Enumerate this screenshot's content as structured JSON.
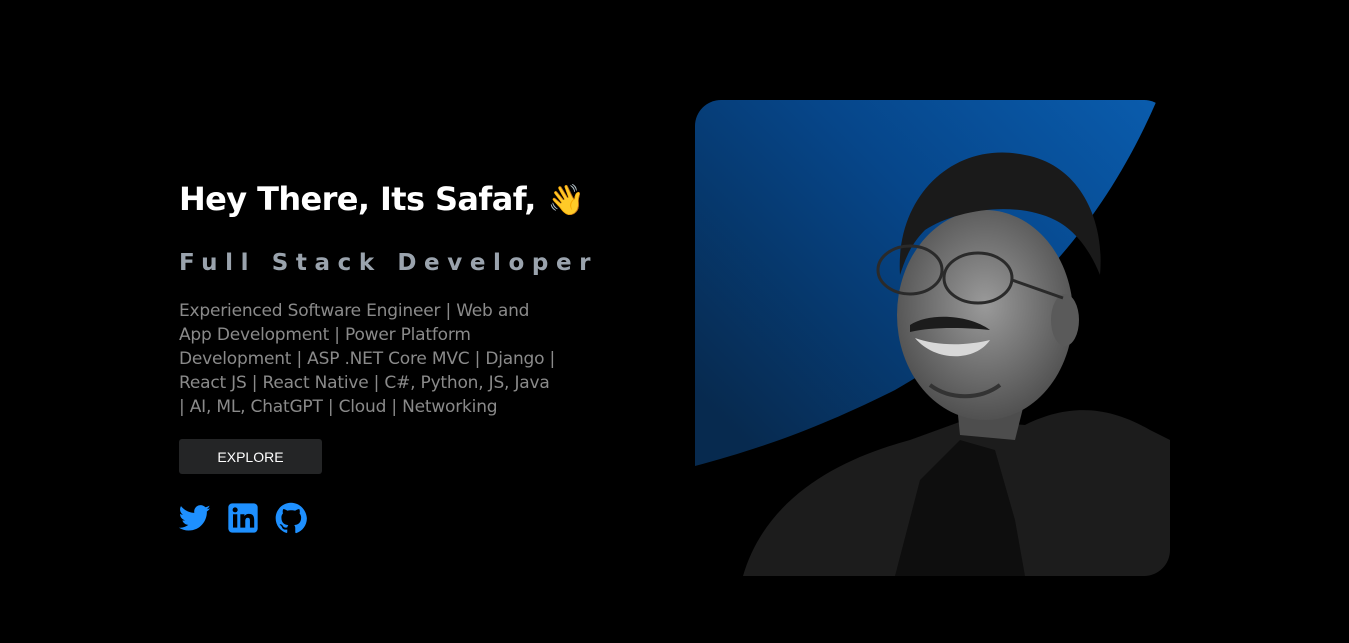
{
  "hero": {
    "greeting": "Hey There, Its Safaf,",
    "wave_emoji": "👋",
    "role": "Full Stack Developer",
    "bio": "Experienced Software Engineer | Web and App Development | Power Platform Development | ASP .NET Core MVC | Django | React JS | React Native | C#, Python, JS, Java | AI, ML, ChatGPT | Cloud | Networking",
    "explore_label": "EXPLORE"
  },
  "social": {
    "icons": [
      "twitter-icon",
      "linkedin-icon",
      "github-icon"
    ],
    "color": "#1e90ff"
  },
  "portrait": {
    "accent_color": "#0a5aa8"
  },
  "colors": {
    "background": "#000000",
    "button_bg": "#242526",
    "role_text": "#9aa3ad",
    "bio_text": "#8a8a8a"
  }
}
